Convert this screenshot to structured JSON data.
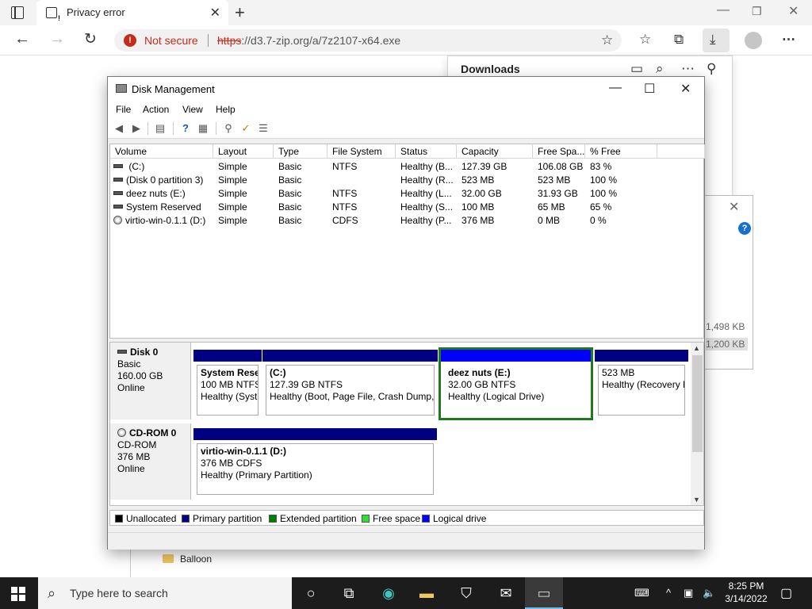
{
  "browser": {
    "tab_title": "Privacy error",
    "security_label": "Not secure",
    "url_scheme": "https",
    "url_rest": "://d3.7-zip.org/a/7z2107-x64.exe",
    "downloads_title": "Downloads",
    "bg_sizes": [
      "1,498 KB",
      "1,200 KB"
    ],
    "bg_folder": "Balloon"
  },
  "dm": {
    "title": "Disk Management",
    "menus": [
      "File",
      "Action",
      "View",
      "Help"
    ],
    "columns": [
      "Volume",
      "Layout",
      "Type",
      "File System",
      "Status",
      "Capacity",
      "Free Spa...",
      "% Free"
    ],
    "rows": [
      {
        "volume": " (C:)",
        "icon": "drive",
        "layout": "Simple",
        "type": "Basic",
        "fs": "NTFS",
        "status": "Healthy (B...",
        "capacity": "127.39 GB",
        "free": "106.08 GB",
        "pct": "83 %"
      },
      {
        "volume": "(Disk 0 partition 3)",
        "icon": "drive",
        "layout": "Simple",
        "type": "Basic",
        "fs": "",
        "status": "Healthy (R...",
        "capacity": "523 MB",
        "free": "523 MB",
        "pct": "100 %"
      },
      {
        "volume": "deez nuts (E:)",
        "icon": "drive",
        "layout": "Simple",
        "type": "Basic",
        "fs": "NTFS",
        "status": "Healthy (L...",
        "capacity": "32.00 GB",
        "free": "31.93 GB",
        "pct": "100 %"
      },
      {
        "volume": "System Reserved",
        "icon": "drive",
        "layout": "Simple",
        "type": "Basic",
        "fs": "NTFS",
        "status": "Healthy (S...",
        "capacity": "100 MB",
        "free": "65 MB",
        "pct": "65 %"
      },
      {
        "volume": "virtio-win-0.1.1 (D:)",
        "icon": "cd",
        "layout": "Simple",
        "type": "Basic",
        "fs": "CDFS",
        "status": "Healthy (P...",
        "capacity": "376 MB",
        "free": "0 MB",
        "pct": "0 %"
      }
    ],
    "disks": [
      {
        "name": "Disk 0",
        "kind": "Basic",
        "size": "160.00 GB",
        "state": "Online",
        "partitions": [
          {
            "name": "System Rese",
            "detail": "100 MB NTFS",
            "status": "Healthy (Syste",
            "bar": "primary",
            "selected": false
          },
          {
            "name": " (C:)",
            "detail": "127.39 GB NTFS",
            "status": "Healthy (Boot, Page File, Crash Dump, P",
            "bar": "primary",
            "selected": false
          },
          {
            "name": "deez nuts  (E:)",
            "detail": "32.00 GB NTFS",
            "status": "Healthy (Logical Drive)",
            "bar": "logical",
            "selected": true
          },
          {
            "name": "",
            "detail": "523 MB",
            "status": "Healthy (Recovery P",
            "bar": "primary",
            "selected": false
          }
        ]
      },
      {
        "name": "CD-ROM 0",
        "kind": "CD-ROM",
        "size": "376 MB",
        "state": "Online",
        "partitions": [
          {
            "name": "virtio-win-0.1.1  (D:)",
            "detail": "376 MB CDFS",
            "status": "Healthy (Primary Partition)",
            "bar": "primary",
            "selected": false
          }
        ]
      }
    ],
    "legend": [
      {
        "label": "Unallocated",
        "color": "#000000"
      },
      {
        "label": "Primary partition",
        "color": "#000080"
      },
      {
        "label": "Extended partition",
        "color": "#008000"
      },
      {
        "label": "Free space",
        "color": "#33dd33"
      },
      {
        "label": "Logical drive",
        "color": "#0000ff"
      }
    ]
  },
  "taskbar": {
    "search_placeholder": "Type here to search",
    "time": "8:25 PM",
    "date": "3/14/2022"
  }
}
